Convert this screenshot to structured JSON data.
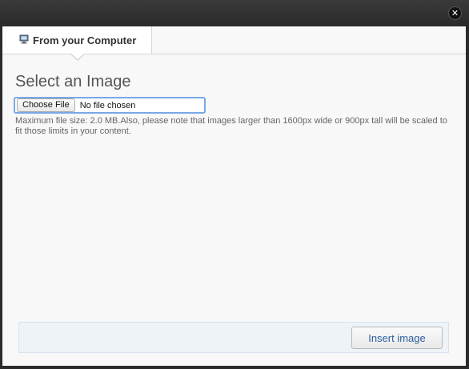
{
  "dialog": {
    "close_icon": "close-icon"
  },
  "tabs": [
    {
      "label": "From your Computer",
      "icon": "computer-icon"
    }
  ],
  "main": {
    "heading": "Select an Image",
    "file_input": {
      "button_label": "Choose File",
      "status": "No file chosen"
    },
    "help_text": "Maximum file size: 2.0 MB.Also, please note that images larger than 1600px wide or 900px tall will be scaled to fit those limits in your content."
  },
  "footer": {
    "insert_label": "Insert image"
  },
  "colors": {
    "accent": "#7aa7e6",
    "button_text": "#2b5f9e"
  }
}
